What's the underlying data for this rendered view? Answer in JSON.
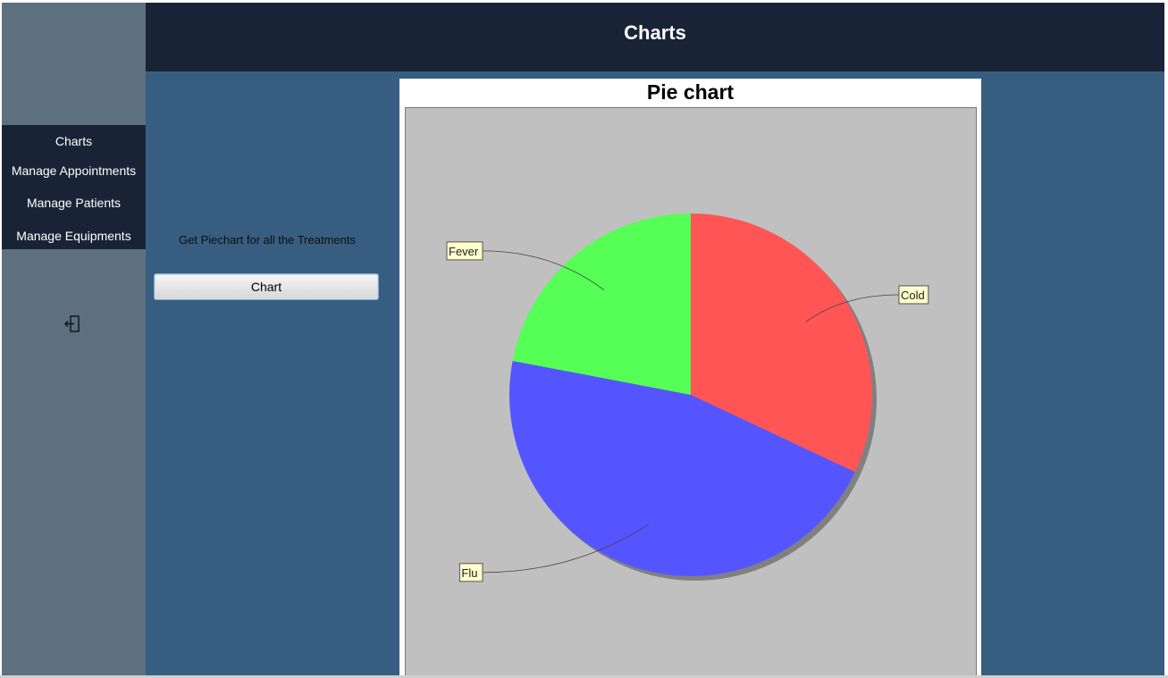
{
  "window": {
    "title": "Charts"
  },
  "sidebar": {
    "items": [
      {
        "label": "Charts"
      },
      {
        "label": "Manage Appointments"
      },
      {
        "label": "Manage Patients"
      },
      {
        "label": "Manage Equipments"
      }
    ],
    "exit_icon": "logout-icon"
  },
  "content": {
    "prompt": "Get Piechart for all the Treatments",
    "button_label": "Chart"
  },
  "chart_data": {
    "type": "pie",
    "title": "Pie chart",
    "categories": [
      "Cold",
      "Flu",
      "Fever"
    ],
    "values": [
      32,
      46,
      22
    ],
    "colors": [
      "#ff5555",
      "#5555ff",
      "#55ff55"
    ],
    "background": "#c0c0c0",
    "legend": "none"
  }
}
